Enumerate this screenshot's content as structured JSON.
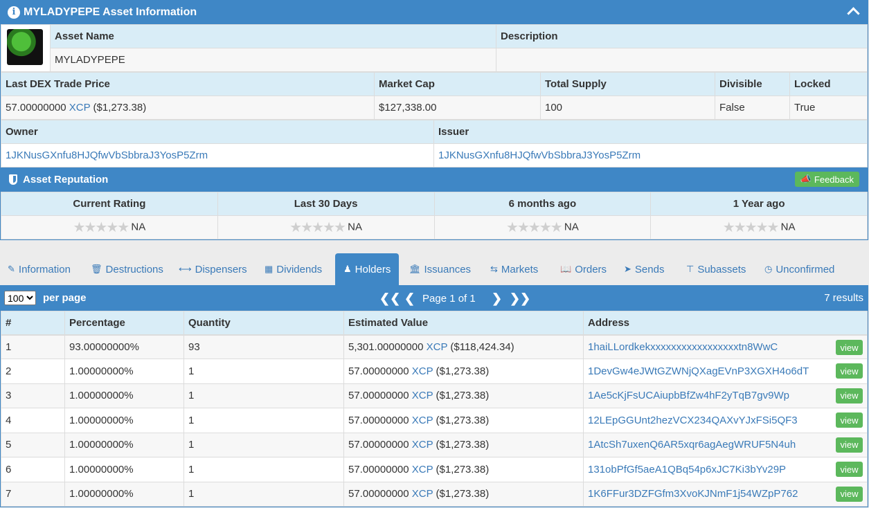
{
  "asset": {
    "title": "MYLADYPEPE Asset Information",
    "name_header": "Asset Name",
    "description_header": "Description",
    "name": "MYLADYPEPE",
    "description": "",
    "price_header": "Last DEX Trade Price",
    "marketcap_header": "Market Cap",
    "supply_header": "Total Supply",
    "divisible_header": "Divisible",
    "locked_header": "Locked",
    "price_amount": "57.00000000",
    "price_unit": "XCP",
    "price_usd": "($1,273.38)",
    "marketcap": "$127,338.00",
    "supply": "100",
    "divisible": "False",
    "locked": "True",
    "owner_header": "Owner",
    "issuer_header": "Issuer",
    "owner": "1JKNusGXnfu8HJQfwVbSbbraJ3YosP5Zrm",
    "issuer": "1JKNusGXnfu8HJQfwVbSbbraJ3YosP5Zrm"
  },
  "reputation": {
    "title": "Asset Reputation",
    "feedback_label": "Feedback",
    "columns": [
      "Current Rating",
      "Last 30 Days",
      "6 months ago",
      "1 Year ago"
    ],
    "values": [
      "NA",
      "NA",
      "NA",
      "NA"
    ]
  },
  "tabs": [
    {
      "label": "Information",
      "icon": "pencil-icon"
    },
    {
      "label": "Destructions",
      "icon": "trash-icon"
    },
    {
      "label": "Dispensers",
      "icon": "arrows-h-icon"
    },
    {
      "label": "Dividends",
      "icon": "sitemap-icon"
    },
    {
      "label": "Holders",
      "icon": "user-icon",
      "active": true
    },
    {
      "label": "Issuances",
      "icon": "bank-icon"
    },
    {
      "label": "Markets",
      "icon": "exchange-icon"
    },
    {
      "label": "Orders",
      "icon": "book-icon"
    },
    {
      "label": "Sends",
      "icon": "send-icon"
    },
    {
      "label": "Subassets",
      "icon": "sub-icon"
    },
    {
      "label": "Unconfirmed",
      "icon": "clock-icon"
    }
  ],
  "holders": {
    "per_page_value": "100",
    "per_page_label": "per page",
    "page_text": "Page 1 of 1",
    "results": "7 results",
    "columns": [
      "#",
      "Percentage",
      "Quantity",
      "Estimated Value",
      "Address"
    ],
    "view_label": "view",
    "rows": [
      {
        "n": "1",
        "pct": "93.00000000%",
        "qty": "93",
        "value": "5,301.00000000",
        "unit": "XCP",
        "usd": "($118,424.34)",
        "address": "1haiLLordkekxxxxxxxxxxxxxxxxxtn8WwC"
      },
      {
        "n": "2",
        "pct": "1.00000000%",
        "qty": "1",
        "value": "57.00000000",
        "unit": "XCP",
        "usd": "($1,273.38)",
        "address": "1DevGw4eJWtGZWNjQXagEVnP3XGXH4o6dT"
      },
      {
        "n": "3",
        "pct": "1.00000000%",
        "qty": "1",
        "value": "57.00000000",
        "unit": "XCP",
        "usd": "($1,273.38)",
        "address": "1Ae5cKjFsUCAiupbBfZw4hF2yTqB7gv9Wp"
      },
      {
        "n": "4",
        "pct": "1.00000000%",
        "qty": "1",
        "value": "57.00000000",
        "unit": "XCP",
        "usd": "($1,273.38)",
        "address": "12LEpGGUnt2hezVCX234QAXvYJxFSi5QF3"
      },
      {
        "n": "5",
        "pct": "1.00000000%",
        "qty": "1",
        "value": "57.00000000",
        "unit": "XCP",
        "usd": "($1,273.38)",
        "address": "1AtcSh7uxenQ6AR5xqr6agAegWRUF5N4uh"
      },
      {
        "n": "6",
        "pct": "1.00000000%",
        "qty": "1",
        "value": "57.00000000",
        "unit": "XCP",
        "usd": "($1,273.38)",
        "address": "131obPfGf5aeA1QBq54p6xJC7Ki3bYv29P"
      },
      {
        "n": "7",
        "pct": "1.00000000%",
        "qty": "1",
        "value": "57.00000000",
        "unit": "XCP",
        "usd": "($1,273.38)",
        "address": "1K6FFur3DZFGfm3XvoKJNmF1j54WZpP762"
      }
    ]
  },
  "colors": {
    "primary": "#3f87c6",
    "header_row": "#d9edf7",
    "success": "#5cb85c",
    "link": "#3a7ab8"
  }
}
